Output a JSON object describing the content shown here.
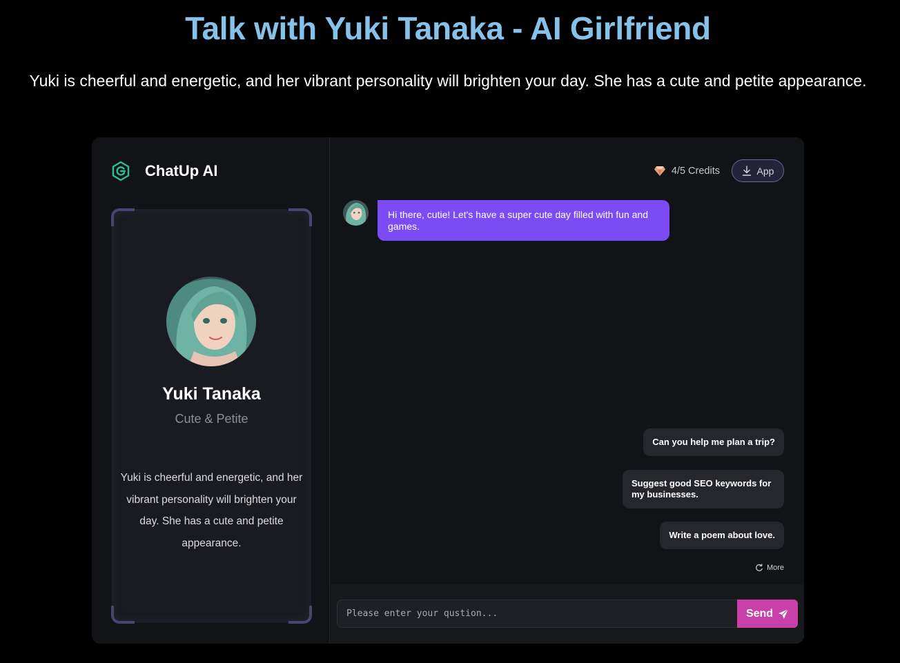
{
  "page": {
    "title": "Talk with Yuki Tanaka - AI Girlfriend",
    "subtitle": "Yuki is cheerful and energetic, and her vibrant personality will brighten your day. She has a cute and petite appearance."
  },
  "sidebar": {
    "brand_name": "ChatUp AI",
    "character": {
      "name": "Yuki Tanaka",
      "tagline": "Cute & Petite",
      "description": "Yuki is cheerful and energetic, and her vibrant personality will brighten your day. She has a cute and petite appearance."
    }
  },
  "topbar": {
    "credits": "4/5 Credits",
    "app_button": "App"
  },
  "chat": {
    "greeting": "Hi there, cutie! Let's have a super cute day filled with fun and games.",
    "suggestions": [
      "Can you help me plan a trip?",
      "Suggest good SEO keywords for my businesses.",
      "Write a poem about love."
    ],
    "more_label": "More"
  },
  "composer": {
    "placeholder": "Please enter your qustion...",
    "send_label": "Send"
  },
  "colors": {
    "title": "#86c1ea",
    "bot_bubble": "#7b4cf6",
    "send_button": "#c941a8",
    "brand_logo": "#2fbf8f"
  }
}
